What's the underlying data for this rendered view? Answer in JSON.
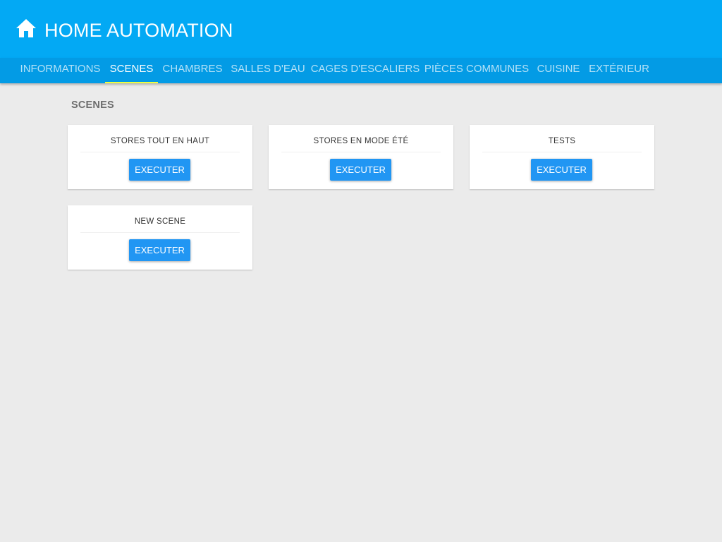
{
  "header": {
    "title": "HOME AUTOMATION",
    "icon": "home-icon",
    "color": "#03a9f4"
  },
  "tabs": [
    {
      "label": "INFORMATIONS",
      "active": false
    },
    {
      "label": "SCENES",
      "active": true
    },
    {
      "label": "CHAMBRES",
      "active": false
    },
    {
      "label": "SALLES D'EAU",
      "active": false
    },
    {
      "label": "CAGES D'ESCALIERS",
      "active": false
    },
    {
      "label": "PIÈCES COMMUNES",
      "active": false
    },
    {
      "label": "CUISINE",
      "active": false
    },
    {
      "label": "EXTÉRIEUR",
      "active": false
    }
  ],
  "tab_bar_color": "#039be5",
  "tab_indicator_color": "#eeff41",
  "section": {
    "title": "SCENES"
  },
  "scenes": [
    {
      "title": "STORES TOUT EN HAUT",
      "button_label": "EXECUTER"
    },
    {
      "title": "STORES EN MODE ÉTÉ",
      "button_label": "EXECUTER"
    },
    {
      "title": "TESTS",
      "button_label": "EXECUTER"
    },
    {
      "title": "NEW SCENE",
      "button_label": "EXECUTER"
    }
  ],
  "button_color": "#2196f3",
  "background_color": "#ebebeb"
}
